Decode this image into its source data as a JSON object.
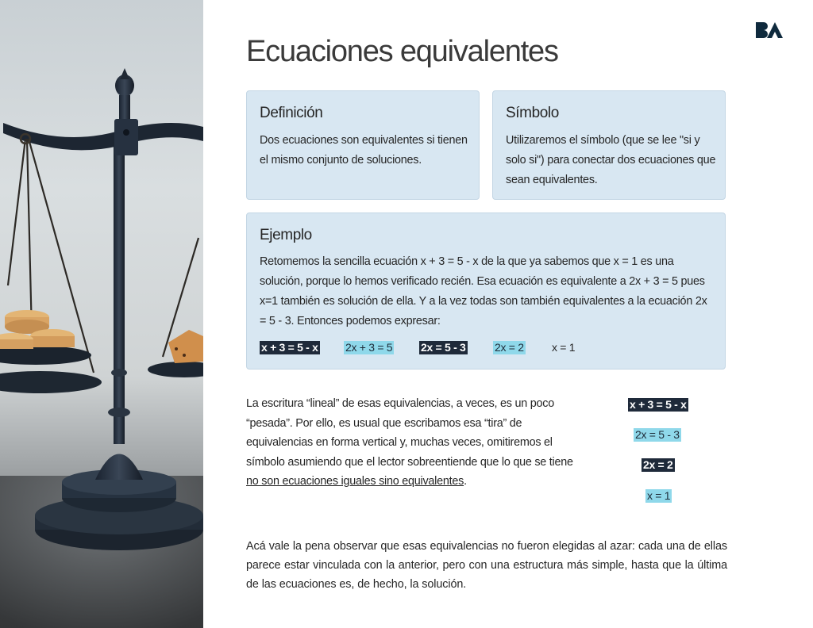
{
  "title": "Ecuaciones equivalentes",
  "logo": {
    "name": "ba-logo-icon",
    "color": "#0f2a3d"
  },
  "definition": {
    "heading": "Definición",
    "text": "Dos ecuaciones son equivalentes si tienen el mismo conjunto de soluciones."
  },
  "symbol": {
    "heading": "Símbolo",
    "text": "Utilizaremos el símbolo     (que se lee \"si y solo si\") para conectar dos ecuaciones que sean equivalentes."
  },
  "example": {
    "heading": "Ejemplo",
    "text": "Retomemos la sencilla ecuación x + 3 = 5 - x de la que ya sabemos que x = 1 es una solución, porque lo hemos verificado recién. Esa ecuación es equivalente a 2x + 3 = 5 pues x=1 también es solución de ella. Y a la vez todas son también equivalentes a la ecuación 2x = 5 - 3. Entonces podemos expresar:",
    "equations": [
      {
        "text": "x + 3 = 5 - x",
        "style": "dark"
      },
      {
        "text": "2x + 3 = 5",
        "style": "light"
      },
      {
        "text": "2x = 5 - 3",
        "style": "dark"
      },
      {
        "text": "2x = 2",
        "style": "light"
      },
      {
        "text": "x = 1",
        "style": "plain"
      }
    ]
  },
  "paragraph": {
    "part1": "La escritura “lineal” de esas equivalencias, a veces, es un poco “pesada”. Por ello, es usual que escribamos esa “tira” de equivalencias en forma vertical y, muchas veces, omitiremos el símbolo     asumiendo que el lector sobreentiende que lo que se tiene ",
    "underlined": "no son ecuaciones iguales sino equivalentes",
    "part2": "."
  },
  "vertical_equations": [
    {
      "text": "x + 3 = 5 - x",
      "style": "dark"
    },
    {
      "text": "2x = 5 - 3",
      "style": "light"
    },
    {
      "text": "2x = 2",
      "style": "dark"
    },
    {
      "text": "x = 1",
      "style": "light"
    }
  ],
  "closing": "Acá vale la pena observar que esas equivalencias no fueron elegidas al azar: cada una de ellas parece estar vinculada con la anterior, pero con una estructura más simple, hasta que la última de las ecuaciones es, de hecho, la solución.",
  "colors": {
    "card_bg": "#d8e7f2",
    "chip_dark": "#1f2a3a",
    "chip_light": "#8fd8ea"
  }
}
